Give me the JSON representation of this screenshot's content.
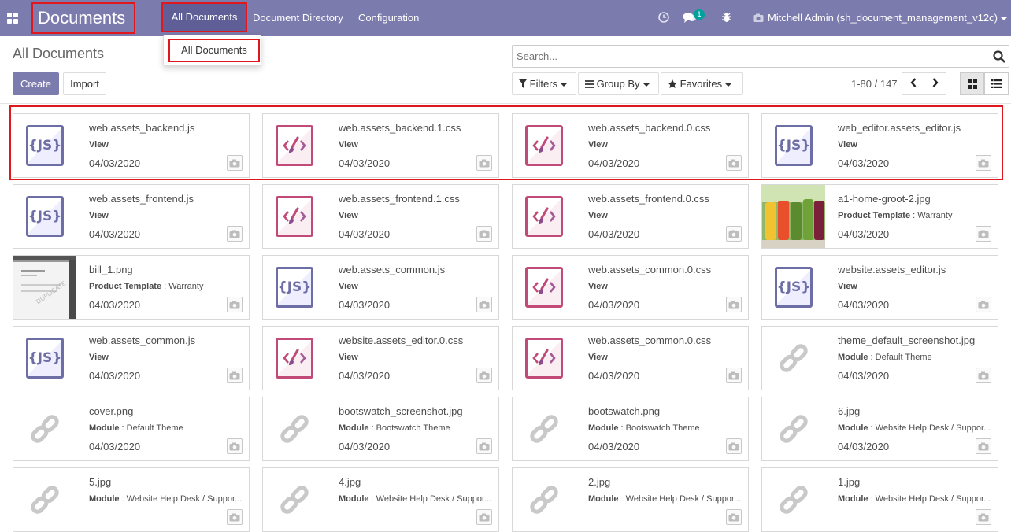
{
  "navbar": {
    "brand": "Documents",
    "menu": [
      "All Documents",
      "Document Directory",
      "Configuration"
    ],
    "messages_badge": "1",
    "user": "Mitchell Admin (sh_document_management_v12c)"
  },
  "dropdown": {
    "item": "All Documents"
  },
  "control": {
    "title": "All Documents",
    "search_placeholder": "Search...",
    "create": "Create",
    "import": "Import",
    "filters": "Filters",
    "group_by": "Group By",
    "favorites": "Favorites",
    "pager": "1-80 / 147"
  },
  "cards": [
    {
      "name": "web.assets_backend.js",
      "type_label": "View",
      "type_value": "",
      "date": "04/03/2020",
      "icon": "js"
    },
    {
      "name": "web.assets_backend.1.css",
      "type_label": "View",
      "type_value": "",
      "date": "04/03/2020",
      "icon": "css"
    },
    {
      "name": "web.assets_backend.0.css",
      "type_label": "View",
      "type_value": "",
      "date": "04/03/2020",
      "icon": "css"
    },
    {
      "name": "web_editor.assets_editor.js",
      "type_label": "View",
      "type_value": "",
      "date": "04/03/2020",
      "icon": "js"
    },
    {
      "name": "web.assets_frontend.js",
      "type_label": "View",
      "type_value": "",
      "date": "04/03/2020",
      "icon": "js"
    },
    {
      "name": "web.assets_frontend.1.css",
      "type_label": "View",
      "type_value": "",
      "date": "04/03/2020",
      "icon": "css"
    },
    {
      "name": "web.assets_frontend.0.css",
      "type_label": "View",
      "type_value": "",
      "date": "04/03/2020",
      "icon": "css"
    },
    {
      "name": "a1-home-groot-2.jpg",
      "type_label": "Product Template",
      "type_value": " : Warranty",
      "date": "04/03/2020",
      "icon": "photo-juice"
    },
    {
      "name": "bill_1.png",
      "type_label": "Product Template",
      "type_value": " : Warranty",
      "date": "04/03/2020",
      "icon": "photo-bill"
    },
    {
      "name": "web.assets_common.js",
      "type_label": "View",
      "type_value": "",
      "date": "04/03/2020",
      "icon": "js"
    },
    {
      "name": "web.assets_common.0.css",
      "type_label": "View",
      "type_value": "",
      "date": "04/03/2020",
      "icon": "css"
    },
    {
      "name": "website.assets_editor.js",
      "type_label": "View",
      "type_value": "",
      "date": "04/03/2020",
      "icon": "js"
    },
    {
      "name": "web.assets_common.js",
      "type_label": "View",
      "type_value": "",
      "date": "04/03/2020",
      "icon": "js"
    },
    {
      "name": "website.assets_editor.0.css",
      "type_label": "View",
      "type_value": "",
      "date": "04/03/2020",
      "icon": "css"
    },
    {
      "name": "web.assets_common.0.css",
      "type_label": "View",
      "type_value": "",
      "date": "04/03/2020",
      "icon": "css"
    },
    {
      "name": "theme_default_screenshot.jpg",
      "type_label": "Module",
      "type_value": " : Default Theme",
      "date": "04/03/2020",
      "icon": "link"
    },
    {
      "name": "cover.png",
      "type_label": "Module",
      "type_value": " : Default Theme",
      "date": "04/03/2020",
      "icon": "link"
    },
    {
      "name": "bootswatch_screenshot.jpg",
      "type_label": "Module",
      "type_value": " : Bootswatch Theme",
      "date": "04/03/2020",
      "icon": "link"
    },
    {
      "name": "bootswatch.png",
      "type_label": "Module",
      "type_value": " : Bootswatch Theme",
      "date": "04/03/2020",
      "icon": "link"
    },
    {
      "name": "6.jpg",
      "type_label": "Module",
      "type_value": " : Website Help Desk / Suppor...",
      "date": "04/03/2020",
      "icon": "link"
    },
    {
      "name": "5.jpg",
      "type_label": "Module",
      "type_value": " : Website Help Desk / Suppor...",
      "date": "",
      "icon": "link"
    },
    {
      "name": "4.jpg",
      "type_label": "Module",
      "type_value": " : Website Help Desk / Suppor...",
      "date": "",
      "icon": "link"
    },
    {
      "name": "2.jpg",
      "type_label": "Module",
      "type_value": " : Website Help Desk / Suppor...",
      "date": "",
      "icon": "link"
    },
    {
      "name": "1.jpg",
      "type_label": "Module",
      "type_value": " : Website Help Desk / Suppor...",
      "date": "",
      "icon": "link"
    }
  ],
  "colors": {
    "navbar": "#7c7bad",
    "highlight": "#e0181e",
    "js_icon": "#6e6ea6",
    "css_icon": "#c24a78"
  }
}
